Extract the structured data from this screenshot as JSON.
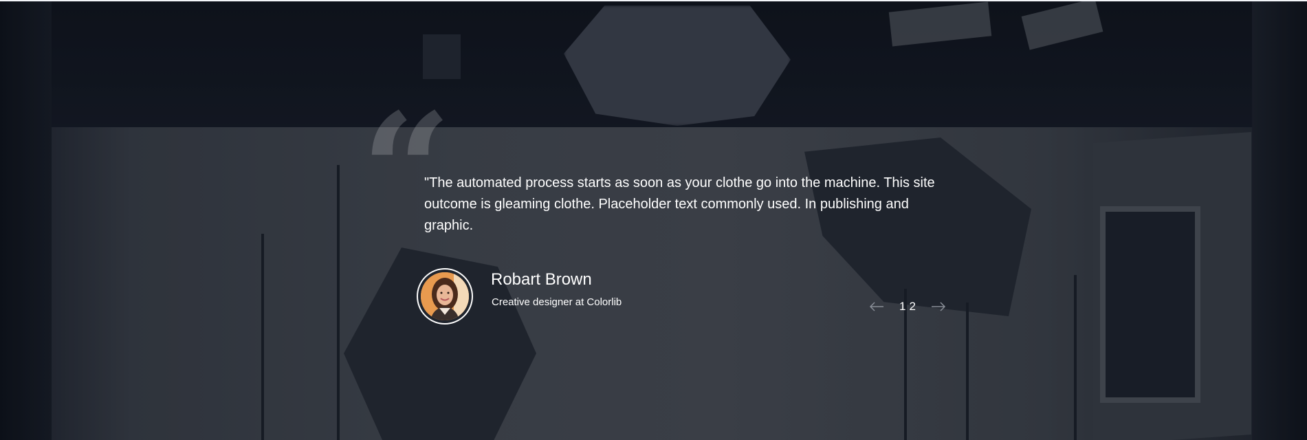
{
  "testimonial": {
    "quote": "\"The automated process starts as soon as your clothe go into the machine. This site outcome is gleaming clothe. Placeholder text commonly used. In publishing and graphic.",
    "quote_icon": "quote-mark-icon",
    "author": {
      "name": "Robart Brown",
      "role": "Creative designer at Colorlib"
    }
  },
  "slider": {
    "prev_icon": "arrow-left-icon",
    "next_icon": "arrow-right-icon",
    "pages": [
      "1",
      "2"
    ]
  },
  "colors": {
    "text": "#ffffff",
    "arrow": "#8a8f98",
    "quote_mark": "rgba(255,255,255,0.18)"
  }
}
